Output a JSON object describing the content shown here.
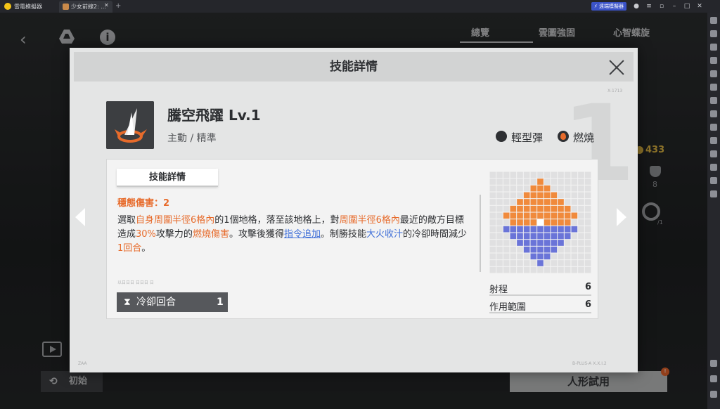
{
  "emulator": {
    "app_name": "雷電模擬器",
    "tab_label": "少女前線2: ...",
    "tab_close": "✕",
    "add_tab": "+",
    "pill_button": "⚡ 遠端模擬器"
  },
  "game": {
    "tabs": [
      "總覽",
      "雲圖強固",
      "心智蝶旋"
    ],
    "coins": "433",
    "shield_count": "8",
    "gear_suffix": "/1",
    "reset_label": "初始",
    "trial_label": "人形試用",
    "badge": "!"
  },
  "modal": {
    "title": "技能詳情",
    "bg_number": "1",
    "top_small": "X-1713",
    "footer_left": "ZAA",
    "footer_right": "B-PLUS-A  X.X.I.2",
    "skill": {
      "name": "騰空飛躍 Lv.1",
      "subtitle": "主動 / 精準",
      "tags": [
        "輕型彈",
        "燃燒"
      ]
    },
    "card": {
      "tab_label": "技能詳情",
      "stagger": "穩態傷害：2",
      "desc": [
        {
          "t": "選取",
          "c": ""
        },
        {
          "t": "自身周圍半徑6格內",
          "c": "o"
        },
        {
          "t": "的1個地格，落至該地格上，對",
          "c": ""
        },
        {
          "t": "周圍半徑6格內",
          "c": "o"
        },
        {
          "t": "最近的敵方目標造成",
          "c": ""
        },
        {
          "t": "30%",
          "c": "o"
        },
        {
          "t": "攻擊力的",
          "c": ""
        },
        {
          "t": "燃燒傷害",
          "c": "o"
        },
        {
          "t": "。攻擊後獲得",
          "c": ""
        },
        {
          "t": "指令追加",
          "c": "u"
        },
        {
          "t": "。制勝技能",
          "c": ""
        },
        {
          "t": "大火收汁",
          "c": "b"
        },
        {
          "t": "的冷卻時間減少",
          "c": ""
        },
        {
          "t": "1回合",
          "c": "o"
        },
        {
          "t": "。",
          "c": ""
        }
      ],
      "faded_text": "以日日日 日日日 日",
      "cooldown_label": "冷卻回合",
      "cooldown_value": "1",
      "stats": [
        {
          "label": "射程",
          "value": "6"
        },
        {
          "label": "作用範圍",
          "value": "6"
        }
      ],
      "grid": {
        "size": 15,
        "range_radius": 6,
        "center": [
          7,
          7
        ],
        "colors": {
          "empty": "#e0e0e1",
          "range": "#f08a3c",
          "area": "#6a74d8",
          "center": "#ffffff"
        }
      }
    }
  },
  "colors": {
    "accent_orange": "#e76b2b",
    "accent_blue": "#3f6fd8",
    "modal_bg": "#e4e5e5"
  }
}
